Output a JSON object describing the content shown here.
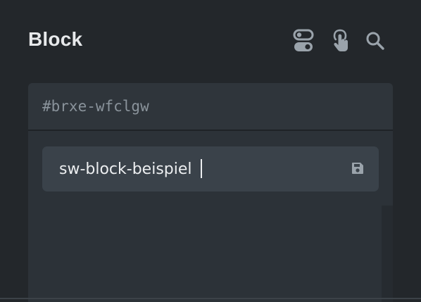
{
  "panel": {
    "title": "Block"
  },
  "header_icons": [
    {
      "name": "toggle-icon"
    },
    {
      "name": "pointer-hand-icon"
    },
    {
      "name": "search-icon"
    }
  ],
  "selector": {
    "css_id": "#brxe-wfclgw"
  },
  "class_input": {
    "value": "sw-block-beispiel",
    "save_icon": "save-icon"
  },
  "colors": {
    "background": "#23272b",
    "card": "#2c3238",
    "input": "#3a424a",
    "text": "#eceef0",
    "muted": "#8a939b"
  }
}
